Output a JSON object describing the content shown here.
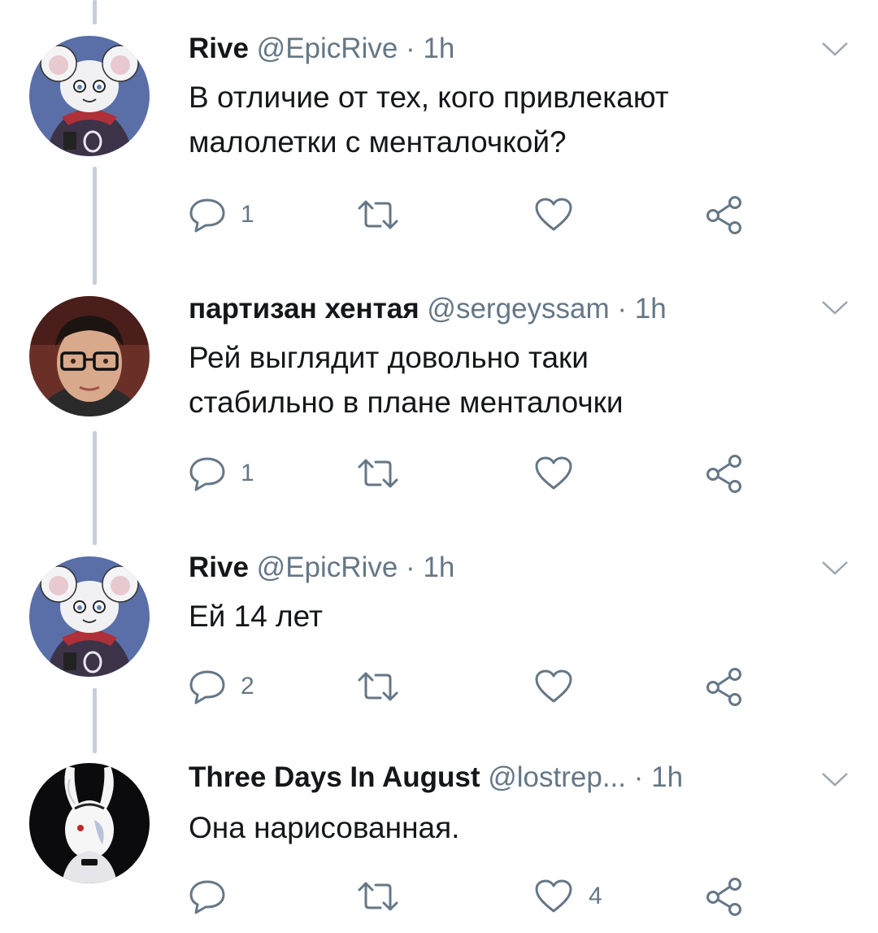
{
  "tweets": [
    {
      "name": "Rive",
      "handle": "@EpicRive",
      "separator": "·",
      "time": "1h",
      "text": [
        "В отличие от тех, кого привлекают",
        "малолетки с менталочкой?"
      ],
      "reply_count": "1",
      "retweet_count": "",
      "like_count": "",
      "avatar": "avatar-mouse-character"
    },
    {
      "name": "партизан хентая",
      "handle": "@sergeyssam",
      "separator": "·",
      "time": "1h",
      "text": [
        "Рей выглядит довольно таки",
        "стабильно в плане менталочки"
      ],
      "reply_count": "1",
      "retweet_count": "",
      "like_count": "",
      "avatar": "avatar-person-glasses"
    },
    {
      "name": "Rive",
      "handle": "@EpicRive",
      "separator": "·",
      "time": "1h",
      "text": [
        "Ей 14 лет"
      ],
      "reply_count": "2",
      "retweet_count": "",
      "like_count": "",
      "avatar": "avatar-mouse-character"
    },
    {
      "name": "Three Days In August",
      "handle": "@lostrep...",
      "separator": "·",
      "time": "1h",
      "text": [
        "Она нарисованная."
      ],
      "reply_count": "",
      "retweet_count": "",
      "like_count": "4",
      "avatar": "avatar-white-rabbit"
    }
  ],
  "icons": {
    "reply": "reply-icon",
    "retweet": "retweet-icon",
    "like": "like-icon",
    "share": "share-icon",
    "menu": "chevron-down-icon"
  },
  "colors": {
    "text": "#14171a",
    "secondary": "#657786",
    "thread_line": "#c4cfd6"
  }
}
